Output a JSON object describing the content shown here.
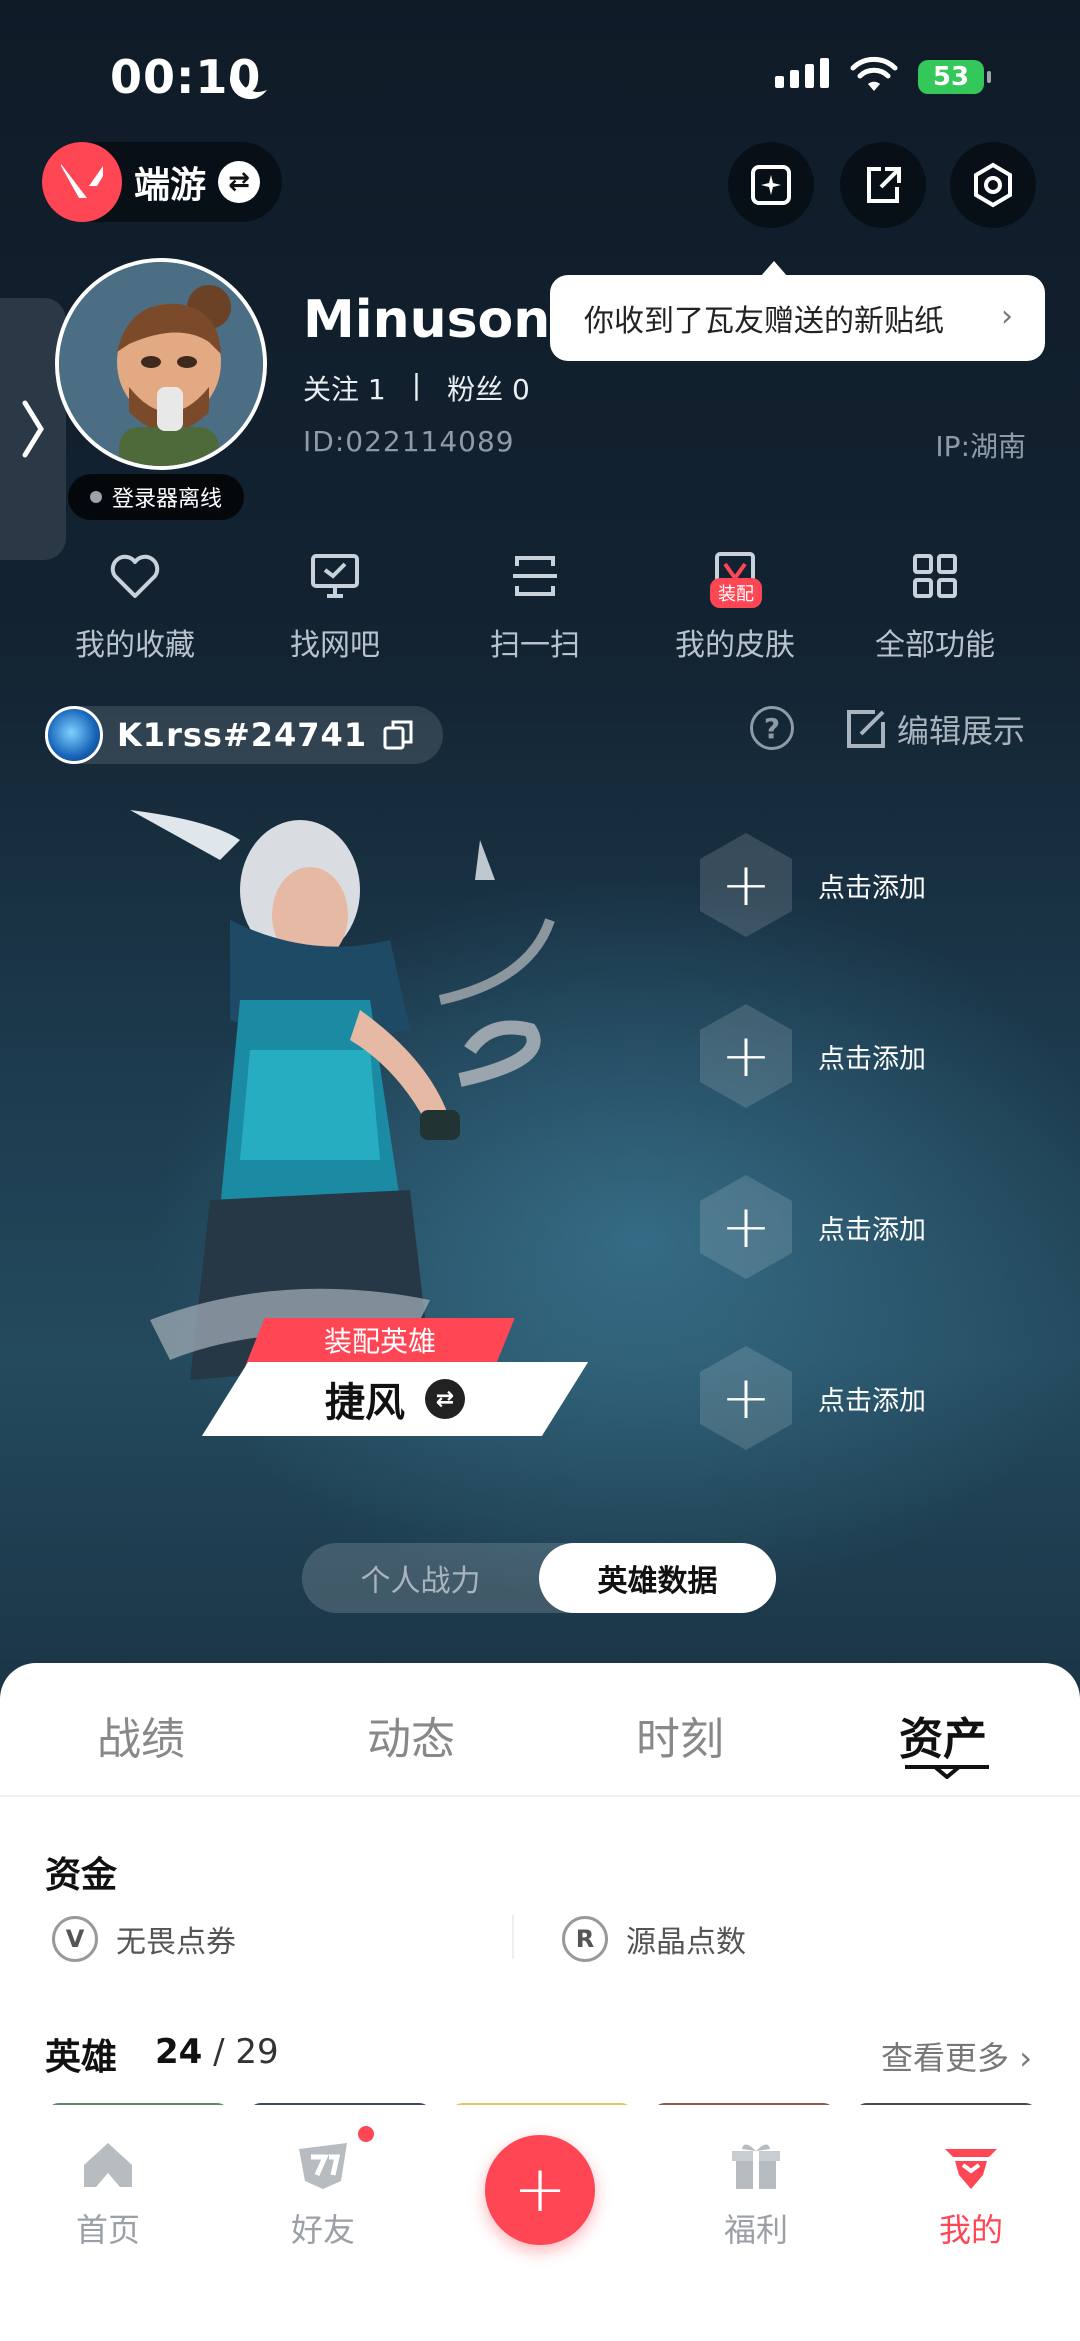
{
  "status_bar": {
    "time": "00:10",
    "battery": "53"
  },
  "header": {
    "app_name": "端游"
  },
  "profile": {
    "username": "Minusone.",
    "follow_label": "关注 1",
    "fans_label": "粉丝 0",
    "separator": "|",
    "id": "ID:022114089",
    "ip": "IP:湖南",
    "status": "登录器离线"
  },
  "tooltip": {
    "text": "你收到了瓦友赠送的新贴纸"
  },
  "quick_actions": [
    {
      "label": "我的收藏",
      "icon": "heart-icon"
    },
    {
      "label": "找网吧",
      "icon": "monitor-icon"
    },
    {
      "label": "扫一扫",
      "icon": "scan-icon"
    },
    {
      "label": "我的皮肤",
      "icon": "skin-icon"
    },
    {
      "label": "全部功能",
      "icon": "grid-icon"
    }
  ],
  "skin_badge": "装配",
  "player": {
    "riot_id": "K1rss#24741",
    "edit_label": "编辑展示"
  },
  "hero": {
    "equip_label": "装配英雄",
    "agent_name": "捷风",
    "slots": [
      "点击添加",
      "点击添加",
      "点击添加",
      "点击添加"
    ]
  },
  "segment": {
    "options": [
      "个人战力",
      "英雄数据"
    ],
    "selected": "英雄数据"
  },
  "tabs": [
    "战绩",
    "动态",
    "时刻",
    "资产"
  ],
  "active_tab": "资产",
  "assets": {
    "funds_title": "资金",
    "currencies": [
      "无畏点券",
      "源晶点数"
    ],
    "heroes_title": "英雄",
    "heroes_owned": "24",
    "heroes_total": "29",
    "heroes_sep": "/",
    "view_more": "查看更多"
  },
  "bottom_nav": [
    {
      "label": "首页",
      "icon": "home-icon"
    },
    {
      "label": "好友",
      "icon": "friends-icon"
    },
    {
      "label": "福利",
      "icon": "gift-icon"
    },
    {
      "label": "我的",
      "icon": "me-icon"
    }
  ],
  "colors": {
    "accent": "#ff4655",
    "sheet": "#ffffff",
    "bg": "#0f1b27"
  }
}
